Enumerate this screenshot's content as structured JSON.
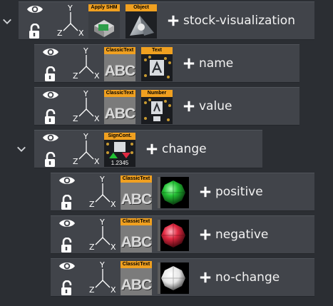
{
  "icons": {
    "visibility": "eye-icon",
    "lock": "unlock-icon",
    "axes": "xyz-axes-icon",
    "add": "plus-icon",
    "expand": "chevron-down-icon"
  },
  "axis_labels": {
    "x": "X",
    "y": "Y",
    "z": "Z"
  },
  "colors": {
    "row_background": "#41444a",
    "panel_background": "#2b2e33",
    "tag_orange": "#f0a020",
    "positive_green": "#22c033",
    "negative_red": "#e02840",
    "neutral_white": "#f2f2f2"
  },
  "nodes": [
    {
      "label": "stock-visualization",
      "expanded": true,
      "tags": [
        "Apply SHM",
        "Object"
      ],
      "tile_art": [
        "shm-icon",
        "object-icon"
      ]
    },
    {
      "label": "name",
      "expanded": false,
      "tags": [
        "ClassicText",
        "Text"
      ],
      "abc": "ABC",
      "tile_art": [
        "classic-text-icon",
        "text-icon"
      ]
    },
    {
      "label": "value",
      "expanded": false,
      "tags": [
        "ClassicText",
        "Number"
      ],
      "abc": "ABC",
      "tile_art": [
        "classic-text-icon",
        "number-icon"
      ]
    },
    {
      "label": "change",
      "expanded": true,
      "tags": [
        "SignCont."
      ],
      "sign_number": "1.2345",
      "tile_art": [
        "sign-control-icon"
      ]
    },
    {
      "label": "positive",
      "expanded": false,
      "tags": [
        "ClassicText"
      ],
      "abc": "ABC",
      "tile_art": [
        "classic-text-icon",
        "green-material-ball"
      ]
    },
    {
      "label": "negative",
      "expanded": false,
      "tags": [
        "ClassicText"
      ],
      "abc": "ABC",
      "tile_art": [
        "classic-text-icon",
        "red-material-ball"
      ]
    },
    {
      "label": "no-change",
      "expanded": false,
      "tags": [
        "ClassicText"
      ],
      "abc": "ABC",
      "tile_art": [
        "classic-text-icon",
        "white-material-ball"
      ]
    }
  ]
}
